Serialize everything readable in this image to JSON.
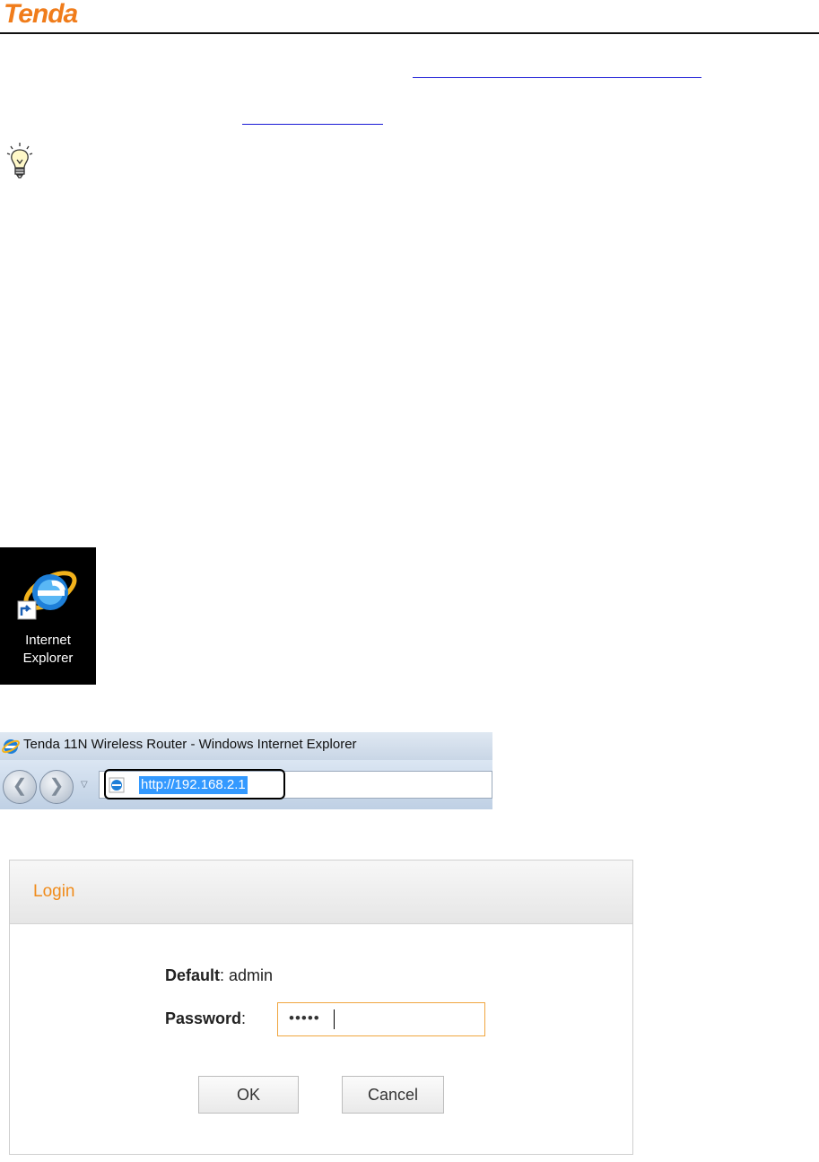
{
  "header": {
    "logo_text": "Tenda"
  },
  "desktop_icon": {
    "label_line1": "Internet",
    "label_line2": "Explorer",
    "icon": "internet-explorer-icon"
  },
  "browser": {
    "window_title": "Tenda 11N Wireless Router - Windows Internet Explorer",
    "url": "http://192.168.2.1",
    "back_icon": "back-arrow-icon",
    "forward_icon": "forward-arrow-icon"
  },
  "login": {
    "title": "Login",
    "default_label": "Default",
    "default_value": ": admin",
    "password_label": "Password",
    "password_sep": ":",
    "password_value": "•••••",
    "ok_label": "OK",
    "cancel_label": "Cancel"
  },
  "colors": {
    "brand": "#f07c1a",
    "login_title": "#f08c1c",
    "link": "#1a1ad6",
    "url_highlight": "#3399ff"
  }
}
